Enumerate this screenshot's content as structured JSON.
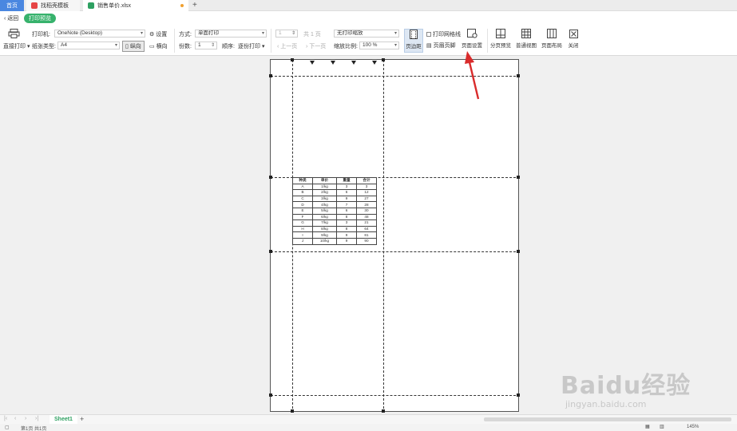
{
  "tabs": {
    "home": "首页",
    "pdf": "找稻壳模板",
    "doc": "销售单价.xlsx"
  },
  "mode": {
    "back": "返回",
    "badge": "打印预览"
  },
  "toolbar": {
    "direct_print": "直接打印",
    "printer_label": "打印机:",
    "printer_value": "OneNote (Desktop)",
    "paper_label": "纸张类型:",
    "paper_value": "A4",
    "settings": "设置",
    "portrait": "纵向",
    "landscape": "横向",
    "method_label": "方式:",
    "method_value": "单面打印",
    "copies_label": "份数:",
    "copies_value": "1",
    "order_label": "顺序:",
    "order_value": "逐份打印",
    "page_value": "1",
    "page_total": "共 1 页",
    "prev_page": "上一页",
    "next_page": "下一页",
    "scale_value": "无打印缩放",
    "zoom_label": "缩放比例:",
    "zoom_value": "100 %",
    "margins": "页边距",
    "gridlines": "打印网格线",
    "header_footer": "页眉页脚",
    "page_setup": "页面设置",
    "page_break_preview": "分页预览",
    "normal_view": "普通视图",
    "page_layout": "页面布局",
    "close": "关闭"
  },
  "table": {
    "headers": [
      "种类",
      "单价",
      "重量",
      "合计"
    ],
    "rows": [
      [
        "A",
        "1/kg",
        "3",
        "3"
      ],
      [
        "B",
        "2/kg",
        "6",
        "12"
      ],
      [
        "C",
        "3/kg",
        "9",
        "27"
      ],
      [
        "D",
        "4/kg",
        "7",
        "28"
      ],
      [
        "E",
        "5/kg",
        "6",
        "30"
      ],
      [
        "F",
        "6/kg",
        "8",
        "48"
      ],
      [
        "G",
        "7/kg",
        "3",
        "21"
      ],
      [
        "H",
        "8/kg",
        "8",
        "64"
      ],
      [
        "I",
        "9/kg",
        "9",
        "81"
      ],
      [
        "J",
        "10/kg",
        "9",
        "90"
      ]
    ]
  },
  "sheet": {
    "tab": "Sheet1"
  },
  "status": {
    "pages": "第1页 共1页",
    "zoom": "145%"
  },
  "watermark": {
    "brand": "Baidu经验",
    "url": "jingyan.baidu.com"
  },
  "colors": {
    "accent_green": "#37b26c",
    "home_tab": "#4a87e0",
    "arrow": "#d92b2b"
  }
}
